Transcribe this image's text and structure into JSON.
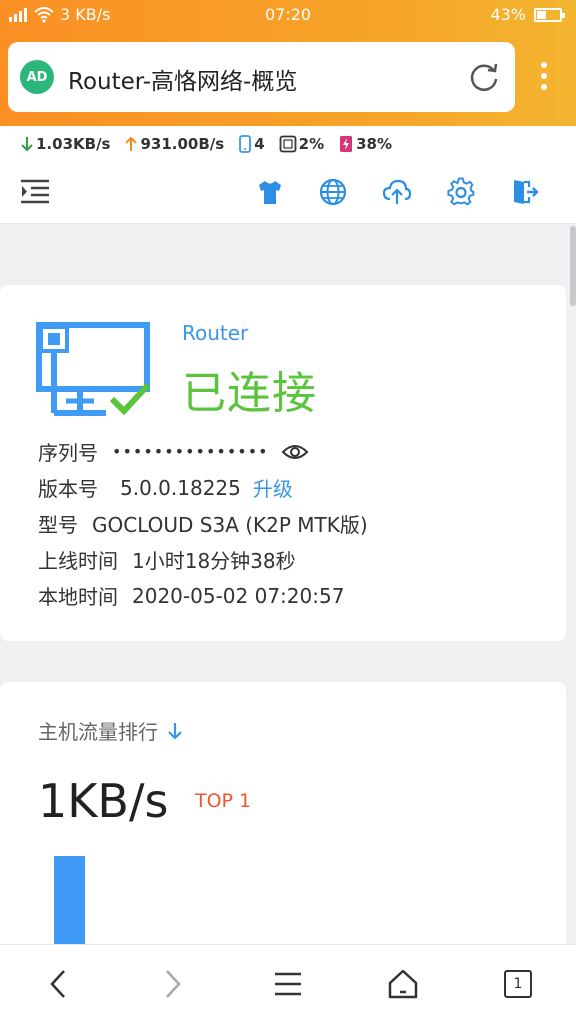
{
  "status_bar": {
    "signal_text": "3 KB/s",
    "time": "07:20",
    "battery": "43%"
  },
  "browser": {
    "ad_badge": "AD",
    "page_title": "Router-高恪网络-概览"
  },
  "traffic": {
    "download": "1.03KB/s",
    "upload": "931.00B/s",
    "devices": "4",
    "cpu": "2%",
    "memory": "38%"
  },
  "router_card": {
    "name": "Router",
    "status": "已连接",
    "serial_label": "序列号",
    "serial_value": "•••••••••••••••",
    "version_label": "版本号",
    "version_value": "5.0.0.18225",
    "upgrade_link": "升级",
    "model_label": "型号",
    "model_value": "GOCLOUD S3A (K2P MTK版)",
    "uptime_label": "上线时间",
    "uptime_value": "1小时18分钟38秒",
    "localtime_label": "本地时间",
    "localtime_value": "2020-05-02 07:20:57"
  },
  "ranking_card": {
    "title": "主机流量排行",
    "rate": "1KB/s",
    "top_tag": "TOP 1",
    "bar_fraction": 1.0
  },
  "bottom_nav": {
    "tab_count": "1"
  },
  "icons": {
    "theme": "shirt-icon",
    "network": "globe-icon",
    "upgrade": "cloud-upload-icon",
    "settings": "gear-icon",
    "logout": "logout-icon"
  },
  "colors": {
    "accent_blue": "#3a96e8",
    "connected_green": "#5ac43c",
    "top_red": "#f0552f",
    "bar_blue": "#3f9bf5",
    "browser_orange": "#fb8f24"
  }
}
